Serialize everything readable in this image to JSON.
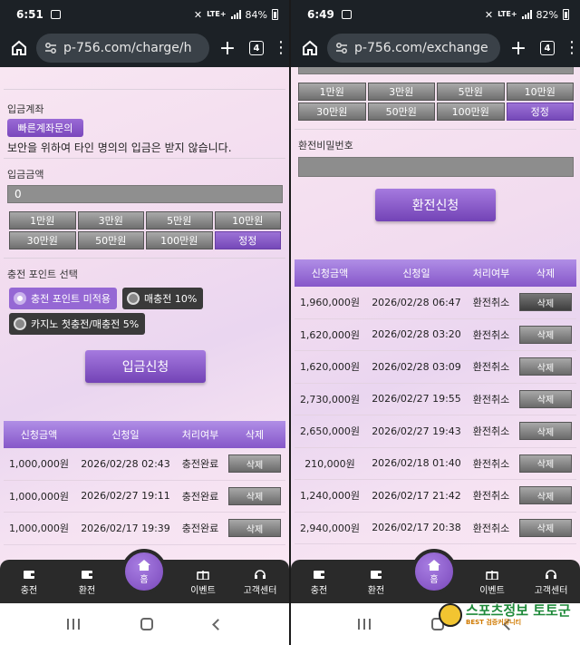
{
  "left": {
    "status": {
      "time": "6:51",
      "network": "LTE+",
      "battery": "84%"
    },
    "url": "p-756.com/charge/h",
    "tab_count": "4",
    "deposit_account_label": "입금계좌",
    "quick_inquiry_button": "빠른계좌문의",
    "security_notice": "보안을 위하여 타인 명의의 입금은 받지 않습니다.",
    "amount_label": "입금금액",
    "amount_value": "0",
    "amount_buttons": [
      "1만원",
      "3만원",
      "5만원",
      "10만원",
      "30만원",
      "50만원",
      "100만원",
      "정정"
    ],
    "point_label": "충전 포인트 선택",
    "point_options": [
      "충전 포인트 미적용",
      "매충전 10%",
      "카지노 첫충전/매충전 5%"
    ],
    "submit_button": "입금신청",
    "table_headers": [
      "신청금액",
      "신청일",
      "처리여부",
      "삭제"
    ],
    "rows": [
      {
        "amount": "1,000,000원",
        "date": "2026/02/28 02:43",
        "status": "충전완료",
        "action": "삭제"
      },
      {
        "amount": "1,000,000원",
        "date": "2026/02/27 19:11",
        "status": "충전완료",
        "action": "삭제"
      },
      {
        "amount": "1,000,000원",
        "date": "2026/02/17 19:39",
        "status": "충전완료",
        "action": "삭제"
      }
    ]
  },
  "right": {
    "status": {
      "time": "6:49",
      "network": "LTE+",
      "battery": "82%"
    },
    "url": "p-756.com/exchange",
    "tab_count": "4",
    "amount_buttons": [
      "1만원",
      "3만원",
      "5만원",
      "10만원",
      "30만원",
      "50만원",
      "100만원",
      "정정"
    ],
    "password_label": "환전비밀번호",
    "submit_button": "환전신청",
    "table_headers": [
      "신청금액",
      "신청일",
      "처리여부",
      "삭제"
    ],
    "rows": [
      {
        "amount": "1,960,000원",
        "date": "2026/02/28 06:47",
        "status": "환전취소",
        "action": "삭제"
      },
      {
        "amount": "1,620,000원",
        "date": "2026/02/28 03:20",
        "status": "환전취소",
        "action": "삭제"
      },
      {
        "amount": "1,620,000원",
        "date": "2026/02/28 03:09",
        "status": "환전취소",
        "action": "삭제"
      },
      {
        "amount": "2,730,000원",
        "date": "2026/02/27 19:55",
        "status": "환전취소",
        "action": "삭제"
      },
      {
        "amount": "2,650,000원",
        "date": "2026/02/27 19:43",
        "status": "환전취소",
        "action": "삭제"
      },
      {
        "amount": "210,000원",
        "date": "2026/02/18 01:40",
        "status": "환전취소",
        "action": "삭제"
      },
      {
        "amount": "1,240,000원",
        "date": "2026/02/17 21:42",
        "status": "환전취소",
        "action": "삭제"
      },
      {
        "amount": "2,940,000원",
        "date": "2026/02/17 20:38",
        "status": "환전취소",
        "action": "삭제"
      }
    ]
  },
  "nav": {
    "charge": "충전",
    "exchange": "환전",
    "home": "홈",
    "event": "이벤트",
    "support": "고객센터"
  },
  "watermark": {
    "title": "스포츠정보 토토군",
    "subtitle": "BEST 검증커뮤니티"
  },
  "colors": {
    "accent": "#8a5cc9",
    "topbar": "#1c2126",
    "nav": "#2a2a2a"
  }
}
